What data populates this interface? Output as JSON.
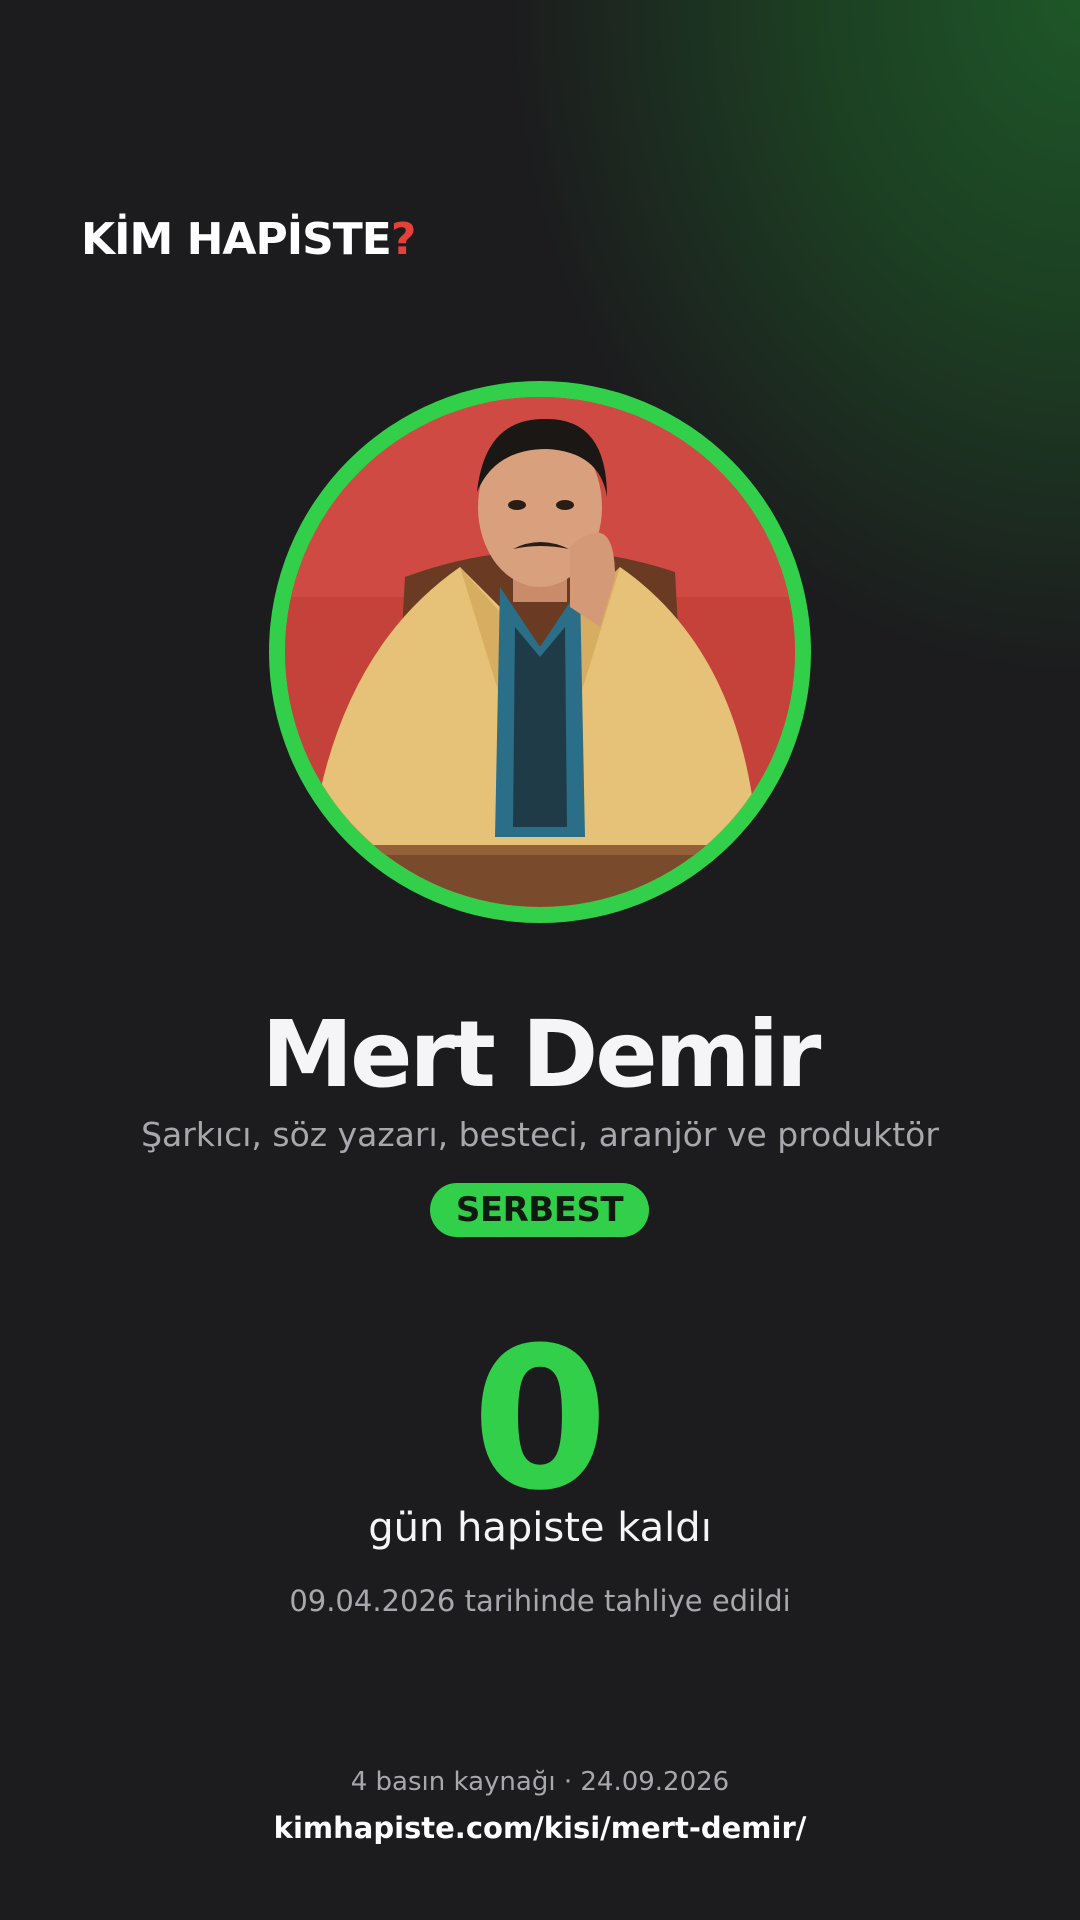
{
  "brand": {
    "name": "KİM HAPİSTE",
    "mark": "?",
    "accent_color": "#e5403a"
  },
  "profile": {
    "photo_alt": "Mert Demir",
    "name": "Mert Demir",
    "occupation": "Şarkıcı, söz yazarı, besteci, aranjör ve produktör",
    "status_badge": "SERBEST",
    "status_color": "#32d04a"
  },
  "stats": {
    "days": "0",
    "days_label": "gün hapiste kaldı",
    "release_text": "09.04.2026 tarihinde tahliye edildi"
  },
  "footer": {
    "sources": "4 basın kaynağı · 24.09.2026",
    "url": "kimhapiste.com/kisi/mert-demir/"
  }
}
